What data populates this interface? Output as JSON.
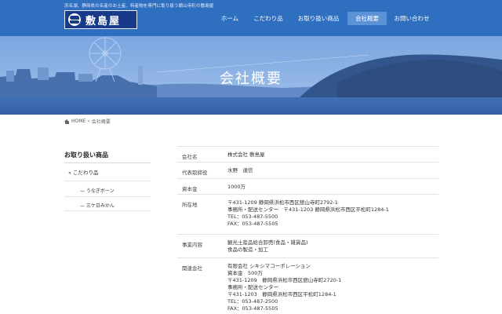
{
  "header": {
    "tagline": "浜名湖、静岡県の名産のお土産、特産物を専門に取り扱う舘山寺町の敷島屋",
    "logo_text": "敷島屋",
    "nav": [
      "ホーム",
      "こだわり品",
      "お取り扱い商品",
      "会社概要",
      "お問い合わせ"
    ],
    "active_nav": "会社概要"
  },
  "hero": {
    "title": "会社概要"
  },
  "breadcrumb": {
    "home": "HOME",
    "separator": "»",
    "current": "会社概要"
  },
  "sidebar": {
    "title": "お取り扱い商品",
    "items": [
      {
        "label": "» こだわり品"
      },
      {
        "label": "— うなぎボーン"
      },
      {
        "label": "— 三ケ日みかん"
      }
    ]
  },
  "company": {
    "rows": [
      {
        "label": "会社名",
        "lines": [
          "株式会社 敷島屋"
        ]
      },
      {
        "label": "代表取締役",
        "lines": [
          "水野　達信"
        ]
      },
      {
        "label": "資本金",
        "lines": [
          "1000万"
        ]
      },
      {
        "label": "所在地",
        "lines": [
          "〒431-1209 静岡県浜松市西区舘山寺町2792-1",
          "事務所・配送センター　〒431-1203 静岡県浜松市西区平松町1284-1",
          "TEL：053-487-5500",
          "FAX：053-487-5505"
        ]
      },
      {
        "label": "事業内容",
        "lines": [
          "観光土産品総合卸売(食品・雑貨品)",
          "食品の製造・加工"
        ]
      },
      {
        "label": "関連会社",
        "lines": [
          "有限会社 シキシマコーポレーション",
          "資本金　500万",
          "〒431-1209　静岡県浜松市西区舘山寺町2720-1",
          "事務所・配送センター",
          "〒431-1203　静岡県浜松市西区平松町1284-1",
          "TEL：053-487-2500",
          "FAX：053-487-5505"
        ]
      }
    ]
  },
  "colors": {
    "header_bg": "#2e6fc0",
    "nav_active_bg": "#5b93d6",
    "logo_bg": "#173b88",
    "hero_tint": "#6f9fdc"
  }
}
